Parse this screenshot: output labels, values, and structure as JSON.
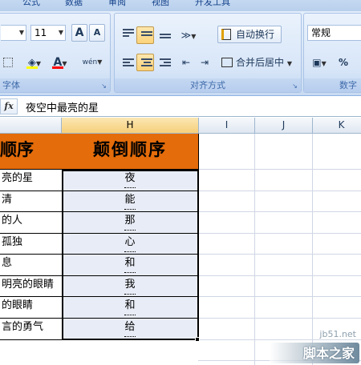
{
  "ribbon": {
    "tabs": [
      "公式",
      "数据",
      "审阅",
      "视图",
      "开发工具"
    ],
    "font_group": {
      "label": "字体",
      "font_size": "11",
      "grow_font_label": "A",
      "shrink_font_label": "A",
      "font_color_label": "A",
      "phonetic_label": "wén"
    },
    "align_group": {
      "label": "对齐方式",
      "wrap_text_label": "自动换行",
      "merge_center_label": "合并后居中"
    },
    "number_group": {
      "label": "数字",
      "number_format": "常规",
      "percent_label": "%"
    }
  },
  "formula_bar": {
    "fx_label": "fx",
    "value": "夜空中最亮的星"
  },
  "columns": [
    "H",
    "I",
    "J",
    "K"
  ],
  "sheet": {
    "g_header": "顺序",
    "h_header": "颠倒顺序",
    "g_values": [
      "亮的星",
      "清",
      "的人",
      "孤独",
      "息",
      "明亮的眼睛",
      "的眼睛",
      "言的勇气"
    ],
    "h_values": [
      "夜",
      "能",
      "那",
      "心",
      "和",
      "我",
      "和",
      "给"
    ]
  },
  "watermark": {
    "url": "jb51.net",
    "logo_text": "脚本之家"
  },
  "colors": {
    "header_fill": "#e46c0a",
    "h_column_fill": "#e8ecf6",
    "selected_header": "#f7cf7a"
  }
}
